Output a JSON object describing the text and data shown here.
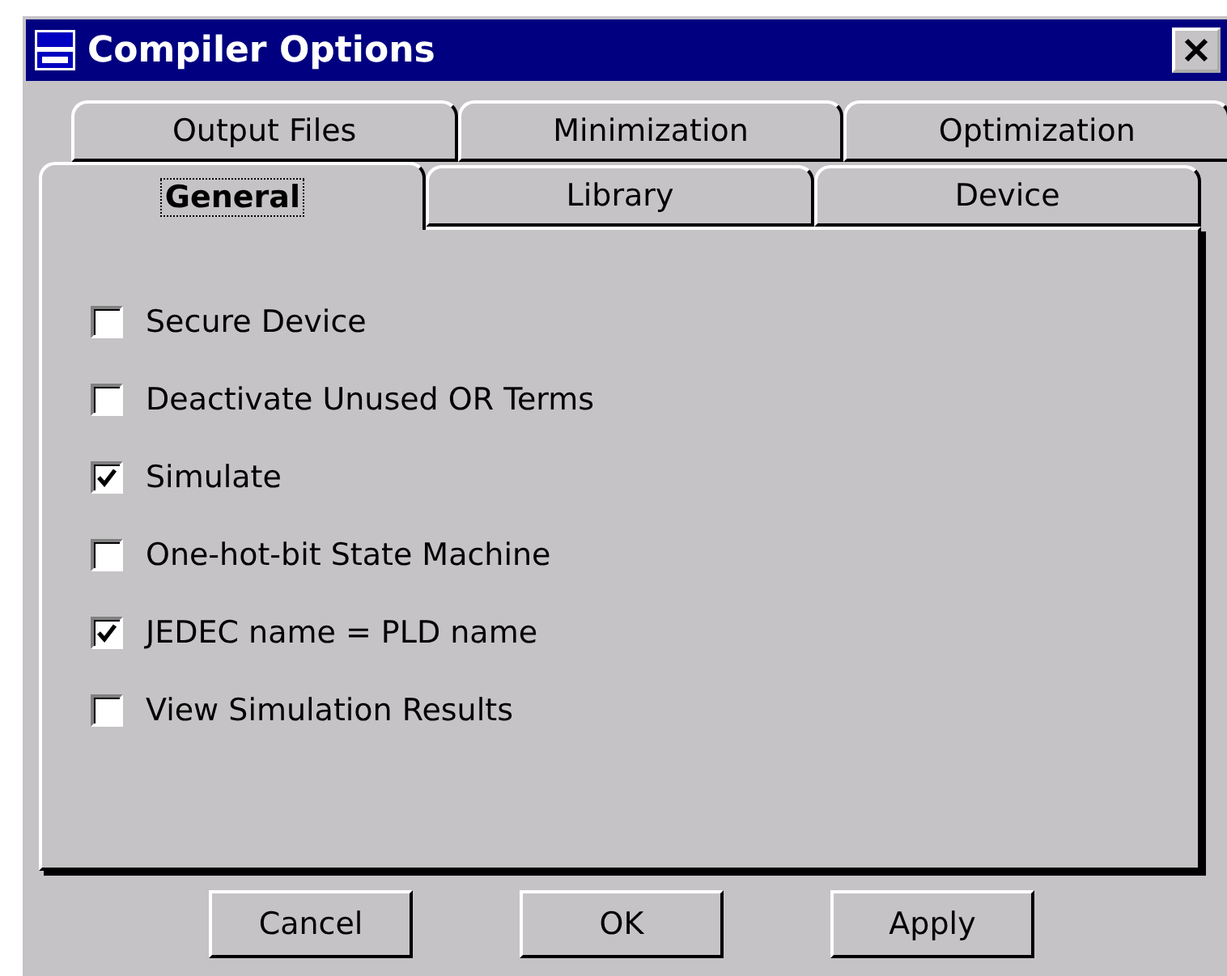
{
  "window": {
    "title": "Compiler Options"
  },
  "tab_rows": [
    [
      {
        "label": "Output Files",
        "selected": false
      },
      {
        "label": "Minimization",
        "selected": false
      },
      {
        "label": "Optimization",
        "selected": false
      }
    ],
    [
      {
        "label": "General",
        "selected": true
      },
      {
        "label": "Library",
        "selected": false
      },
      {
        "label": "Device",
        "selected": false
      }
    ]
  ],
  "options": [
    {
      "label": "Secure Device",
      "checked": false
    },
    {
      "label": "Deactivate Unused OR Terms",
      "checked": false
    },
    {
      "label": "Simulate",
      "checked": true
    },
    {
      "label": "One-hot-bit State Machine",
      "checked": false
    },
    {
      "label": "JEDEC name = PLD name",
      "checked": true
    },
    {
      "label": "View Simulation Results",
      "checked": false
    }
  ],
  "buttons": [
    "Cancel",
    "OK",
    "Apply"
  ]
}
